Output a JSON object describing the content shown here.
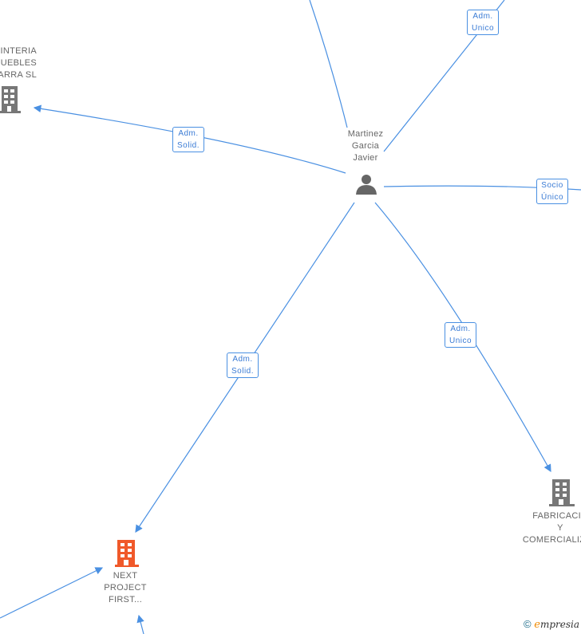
{
  "center": {
    "name": "Martinez\nGarcia\nJavier"
  },
  "nodes": {
    "left_company": "PINTERIA\nUEBLES\nARRA SL",
    "bottom_left_company": "NEXT\nPROJECT\nFIRST...",
    "bottom_right_company": "FABRICACIO\nY\nCOMERCIALIZAC"
  },
  "edge_labels": {
    "top_right": "Adm.\nUnico",
    "left": "Adm.\nSolid.",
    "right": "Socio\nÚnico",
    "bottom_left": "Adm.\nSolid.",
    "bottom_right": "Adm.\nUnico"
  },
  "colors": {
    "edge": "#4a90e2",
    "company": "#777777",
    "highlight_company": "#f0592a",
    "person": "#666666"
  },
  "brand": {
    "copyright": "©",
    "name": "mpresia",
    "initial": "e"
  }
}
